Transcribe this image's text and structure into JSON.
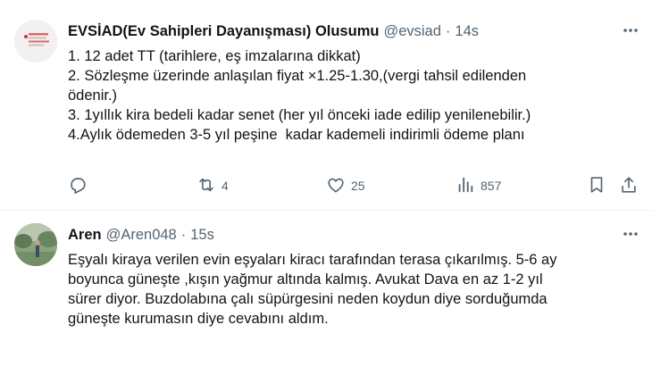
{
  "tweets": [
    {
      "author_name": "EVSİAD(Ev Sahipleri Dayanışması) Olusumu",
      "handle": "@evsiad",
      "separator": "·",
      "time": "14s",
      "lines": [
        "1. 12 adet TT (tarihlere, eş imzalarına dikkat)",
        "2. Sözleşme üzerinde anlaşılan fiyat ×1.25-1.30,(vergi tahsil edilenden",
        "ödenir.)",
        "3. 1yıllık kira bedeli kadar senet (her yıl önceki iade edilip yenilenebilir.)",
        "4.Aylık ödemeden 3-5 yıl peşine  kadar kademeli indirimli ödeme planı"
      ],
      "stats": {
        "replies": "",
        "retweets": "4",
        "likes": "25",
        "views": "857"
      }
    },
    {
      "author_name": "Aren",
      "handle": "@Aren048",
      "separator": "·",
      "time": "15s",
      "lines": [
        "Eşyalı kiraya verilen evin eşyaları kiracı tarafından terasa çıkarılmış. 5-6 ay",
        "boyunca güneşte ,kışın yağmur altında kalmış. Avukat Dava en az 1-2 yıl",
        "sürer diyor. Buzdolabına çalı süpürgesini neden koydun diye sorduğumda",
        "güneşte kurumasın diye cevabını aldım."
      ]
    }
  ],
  "icons": {
    "more": "more-dots-icon",
    "reply": "reply-icon",
    "retweet": "retweet-icon",
    "like": "heart-icon",
    "views": "views-icon",
    "bookmark": "bookmark-icon",
    "share": "share-icon"
  },
  "colors": {
    "text": "#0f1419",
    "secondary": "#536471",
    "divider": "#eff3f4"
  }
}
